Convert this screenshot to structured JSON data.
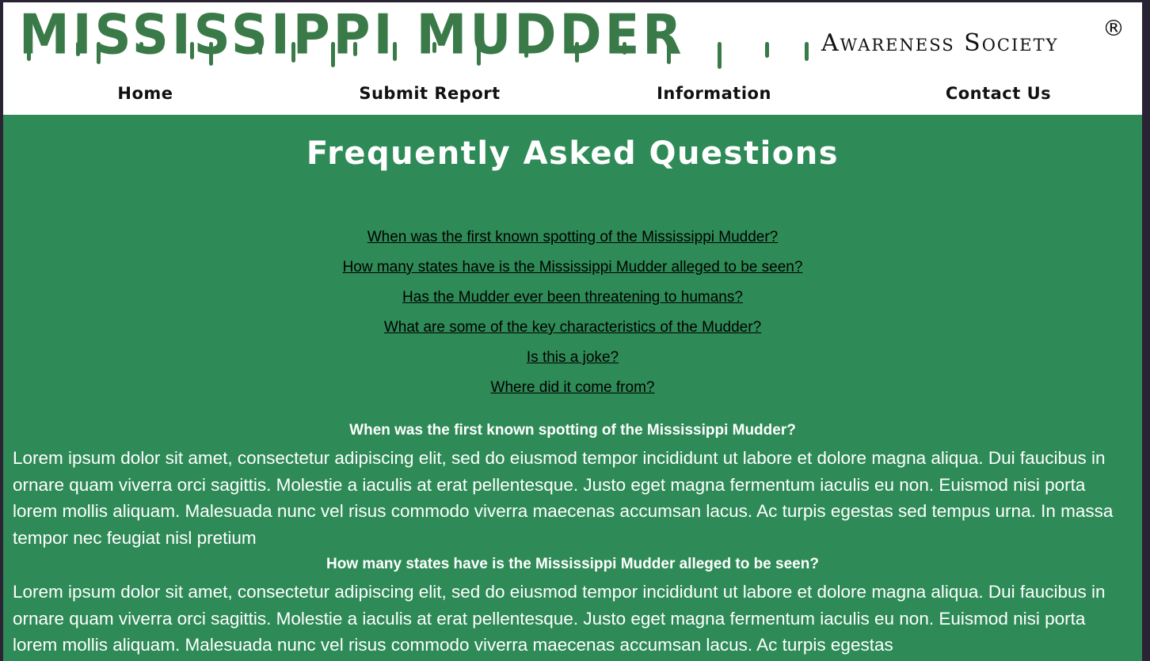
{
  "header": {
    "logo_main": "MISSISSIPPI MUDDER",
    "logo_sub": "Awareness Society",
    "registered_mark": "®"
  },
  "nav": [
    {
      "label": "Home"
    },
    {
      "label": "Submit Report"
    },
    {
      "label": "Information"
    },
    {
      "label": "Contact Us"
    }
  ],
  "page_title": "Frequently Asked Questions",
  "faq_links": [
    "When was the first known spotting of the Mississippi Mudder?",
    "How many states have is the Mississippi Mudder alleged to be seen?",
    "Has the Mudder ever been threatening to humans?",
    "What are some of the key characteristics of the Mudder?",
    "Is this a joke?",
    "Where did it come from?"
  ],
  "sections": [
    {
      "question": "When was the first known spotting of the Mississippi Mudder?",
      "answer": "Lorem ipsum dolor sit amet, consectetur adipiscing elit, sed do eiusmod tempor incididunt ut labore et dolore magna aliqua. Dui faucibus in ornare quam viverra orci sagittis. Molestie a iaculis at erat pellentesque. Justo eget magna fermentum iaculis eu non. Euismod nisi porta lorem mollis aliquam. Malesuada nunc vel risus commodo viverra maecenas accumsan lacus. Ac turpis egestas sed tempus urna. In massa tempor nec feugiat nisl pretium"
    },
    {
      "question": "How many states have is the Mississippi Mudder alleged to be seen?",
      "answer": "Lorem ipsum dolor sit amet, consectetur adipiscing elit, sed do eiusmod tempor incididunt ut labore et dolore magna aliqua. Dui faucibus in ornare quam viverra orci sagittis. Molestie a iaculis at erat pellentesque. Justo eget magna fermentum iaculis eu non. Euismod nisi porta lorem mollis aliquam. Malesuada nunc vel risus commodo viverra maecenas accumsan lacus. Ac turpis egestas"
    }
  ],
  "colors": {
    "background": "#2e8b57",
    "logo_green": "#3a7a48",
    "header_bg": "#ffffff",
    "outer_frame": "#2a2333"
  }
}
